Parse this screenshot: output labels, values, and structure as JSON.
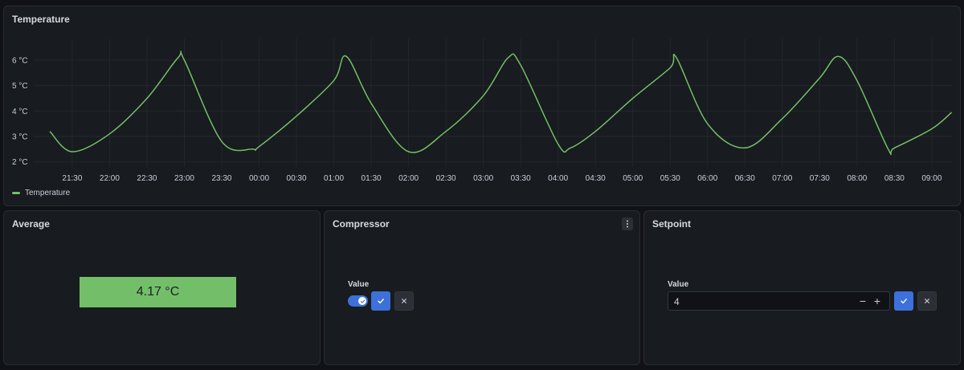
{
  "theme": {
    "series_color": "#73bf69",
    "grid_color": "#24272c",
    "primary_button_color": "#3d71d9",
    "stat_background": "#73bf69"
  },
  "temperature_panel": {
    "title": "Temperature",
    "legend_label": "Temperature"
  },
  "chart_data": {
    "type": "line",
    "title": "Temperature",
    "xlabel": "",
    "ylabel": "",
    "y_unit": "°C",
    "y_tick_labels": [
      "2 °C",
      "3 °C",
      "4 °C",
      "5 °C",
      "6 °C"
    ],
    "y_ticks": [
      2,
      3,
      4,
      5,
      6
    ],
    "ylim": [
      1.8,
      6.6
    ],
    "x_tick_labels": [
      "21:30",
      "22:00",
      "22:30",
      "23:00",
      "23:30",
      "00:00",
      "00:30",
      "01:00",
      "01:30",
      "02:00",
      "02:30",
      "03:00",
      "03:30",
      "04:00",
      "04:30",
      "05:00",
      "05:30",
      "06:00",
      "06:30",
      "07:00",
      "07:30",
      "08:00",
      "08:30",
      "09:00"
    ],
    "x_range_hours": [
      21.2,
      33.27
    ],
    "grid": true,
    "legend": "bottom-left",
    "series": [
      {
        "name": "Temperature",
        "color": "#73bf69",
        "x_time": [
          "21:12",
          "21:30",
          "22:00",
          "22:30",
          "22:55",
          "23:00",
          "23:30",
          "23:55",
          "00:00",
          "00:30",
          "01:00",
          "01:10",
          "01:30",
          "02:00",
          "02:30",
          "03:00",
          "03:20",
          "03:30",
          "04:00",
          "04:10",
          "04:30",
          "05:00",
          "05:30",
          "05:35",
          "06:00",
          "06:30",
          "07:00",
          "07:30",
          "07:45",
          "08:00",
          "08:25",
          "08:30",
          "09:00",
          "09:16"
        ],
        "values": [
          3.2,
          2.4,
          3.1,
          4.5,
          6.1,
          6.0,
          2.8,
          2.5,
          2.6,
          3.8,
          5.2,
          6.15,
          4.3,
          2.4,
          3.2,
          4.6,
          6.1,
          5.8,
          2.7,
          2.55,
          3.2,
          4.5,
          5.7,
          6.1,
          3.5,
          2.55,
          3.7,
          5.3,
          6.15,
          5.2,
          2.5,
          2.55,
          3.3,
          3.95
        ]
      }
    ]
  },
  "average_panel": {
    "title": "Average",
    "value": "4.17 °C"
  },
  "compressor_panel": {
    "title": "Compressor",
    "field_label": "Value",
    "toggle_state": "on",
    "menu_icon": "vertical-ellipsis-icon",
    "confirm_icon": "check-icon",
    "cancel_icon": "close-icon"
  },
  "setpoint_panel": {
    "title": "Setpoint",
    "field_label": "Value",
    "input_value": "4",
    "decrement_symbol": "−",
    "increment_symbol": "+",
    "confirm_icon": "check-icon",
    "cancel_icon": "close-icon"
  }
}
